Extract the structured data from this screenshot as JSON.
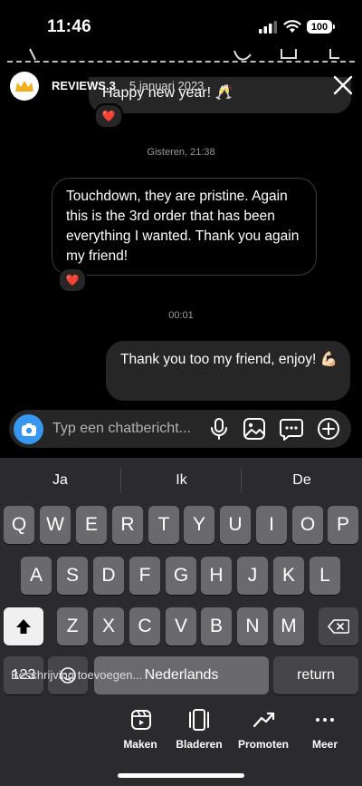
{
  "status_bar": {
    "time": "11:46",
    "battery": "100"
  },
  "header": {
    "username": "REVIEWS.3",
    "date": "5 januari 2023"
  },
  "messages": {
    "previous": {
      "text": "Happy new year! 🥂",
      "reaction": "❤️"
    },
    "timestamp_1": "Gisteren, 21:38",
    "incoming": {
      "text": "Touchdown, they are pristine. Again this is the 3rd order that has been everything I wanted. Thank you again my friend!",
      "reaction": "❤️"
    },
    "timestamp_2": "00:01",
    "outgoing": {
      "text": "Thank you too my friend, enjoy! 💪🏻"
    }
  },
  "composer": {
    "placeholder": "Typ een chatbericht..."
  },
  "keyboard": {
    "suggestions": [
      "Ja",
      "Ik",
      "De"
    ],
    "row1": [
      "Q",
      "W",
      "E",
      "R",
      "T",
      "Y",
      "U",
      "I",
      "O",
      "P"
    ],
    "row2": [
      "A",
      "S",
      "D",
      "F",
      "G",
      "H",
      "J",
      "K",
      "L"
    ],
    "row3": [
      "Z",
      "X",
      "C",
      "V",
      "B",
      "N",
      "M"
    ],
    "numbers_key": "123",
    "space_label": "Nederlands",
    "return_label": "return",
    "overlay_hint": "Beschrijving toevoegen..."
  },
  "story_toolbar": {
    "items": [
      "Maken",
      "Bladeren",
      "Promoten",
      "Meer"
    ]
  },
  "colors": {
    "accent": "#3797f0",
    "bubble": "#262626",
    "keyboard": "#2b2b2d"
  }
}
